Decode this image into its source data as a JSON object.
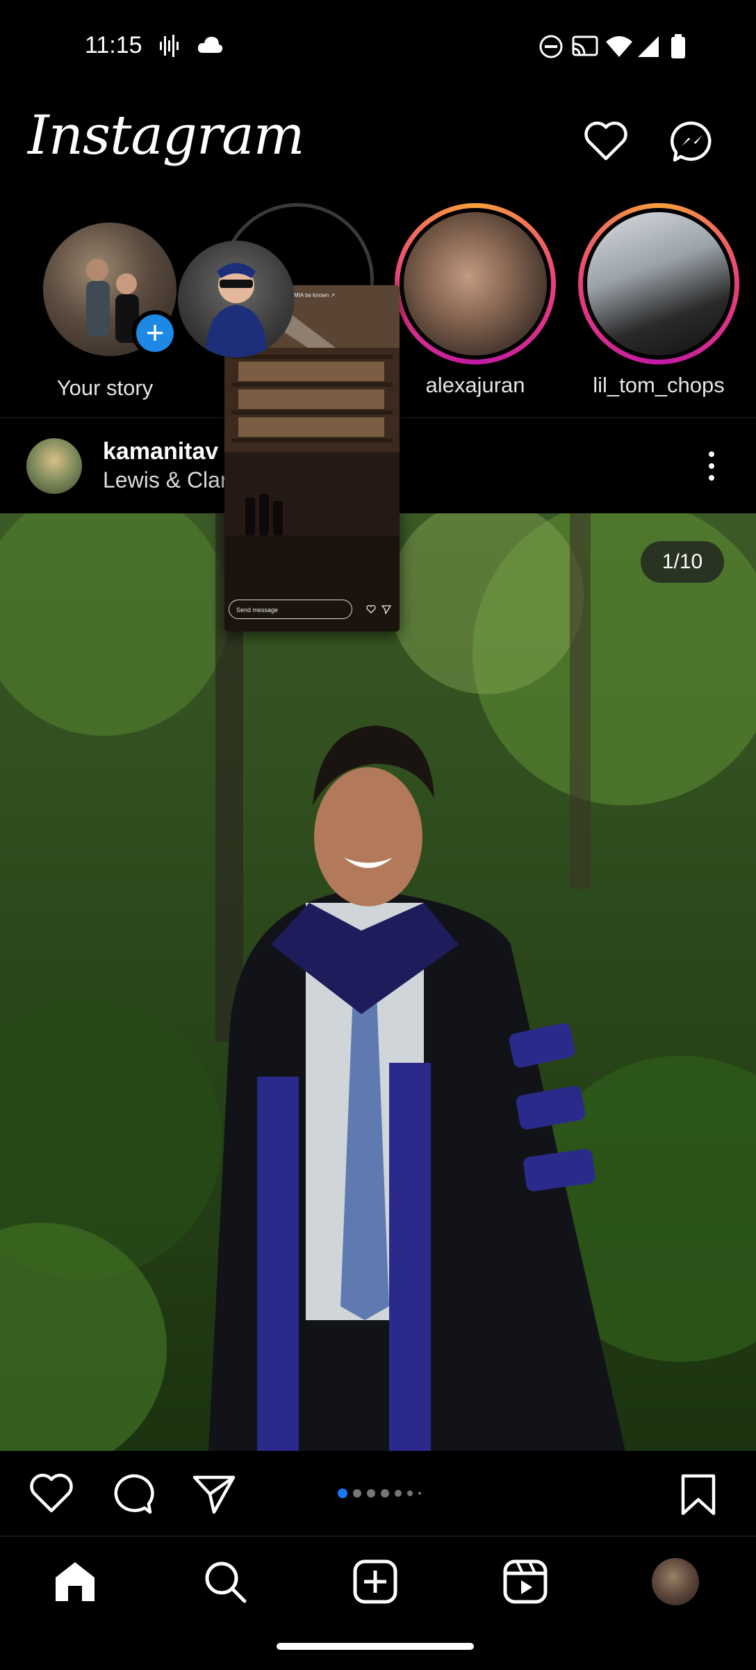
{
  "status_bar": {
    "time": "11:15",
    "left_icons": [
      "voice-wave-icon",
      "cloud-icon"
    ],
    "right_icons": [
      "do-not-disturb-icon",
      "cast-icon",
      "wifi-icon",
      "signal-icon",
      "battery-icon"
    ]
  },
  "header": {
    "logo": "Instagram",
    "icons": [
      "heart-icon",
      "messenger-icon"
    ]
  },
  "stories": [
    {
      "label": "Your story",
      "has_add": true
    },
    {
      "label": "",
      "ring": "seen"
    },
    {
      "label": "alexajuran",
      "ring": "unseen"
    },
    {
      "label": "lil_tom_chops",
      "ring": "unseen"
    }
  ],
  "story_preview": {
    "top_text": "MIA be known ↗",
    "input_placeholder": "Send message"
  },
  "post": {
    "username": "kamanitav",
    "location": "Lewis & Clar",
    "counter": "1/10",
    "carousel_dots": 7,
    "active_dot": 0
  },
  "actions": [
    "heart-icon",
    "comment-icon",
    "share-icon",
    "bookmark-icon"
  ],
  "bottom_nav": [
    "home-icon",
    "search-icon",
    "create-icon",
    "reels-icon",
    "profile-avatar"
  ],
  "colors": {
    "background": "#000000",
    "story_gradient_start": "#f9a13a",
    "story_gradient_end": "#c218a4",
    "active_dot": "#1877f2",
    "add_story_badge": "#1e88e5"
  }
}
